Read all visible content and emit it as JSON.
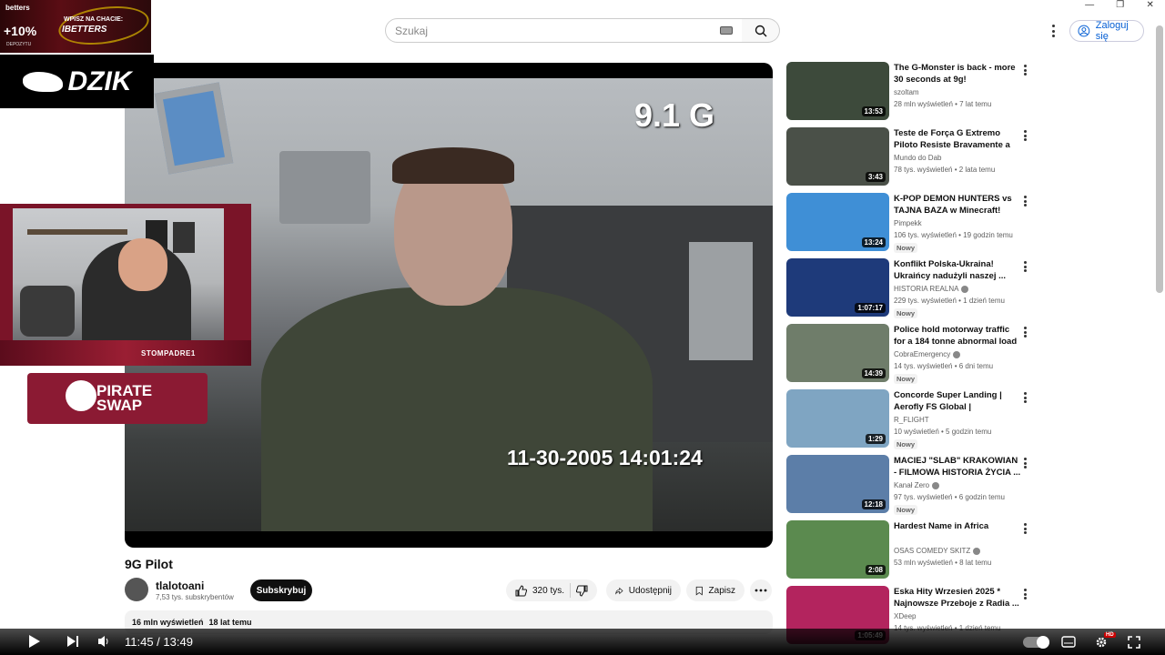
{
  "window": {
    "minimize": "—",
    "restore": "❐",
    "close": "✕"
  },
  "header": {
    "search_placeholder": "Szukaj",
    "signin_label": "Zaloguj się"
  },
  "overlays": {
    "promo": {
      "brand": "betters",
      "bonus": "+10%",
      "bonus_sub": "DEPOZYTU",
      "cta_small": "WPISZ NA CHACIE:",
      "cta_code": "IBETTERS"
    },
    "dzik": "DZIK",
    "cam_handle": "STOMPADRE1",
    "pirate": {
      "line1": "PIRATE",
      "line2": "SWAP"
    }
  },
  "video": {
    "g_readout": "9.1 G",
    "timestamp": "11-30-2005 14:01:24",
    "title": "9G Pilot",
    "channel": "tlalotoani",
    "subscribers": "7,53 tys. subskrybentów",
    "subscribe_label": "Subskrybuj",
    "likes": "320 tys.",
    "share_label": "Udostępnij",
    "save_label": "Zapisz",
    "views": "16 mln wyświetleń",
    "age": "18 lat temu"
  },
  "sidebar": {
    "items": [
      {
        "title": "The G-Monster is back - more 30 seconds at 9g!",
        "channel": "szoltam",
        "verified": false,
        "meta": "28 mln wyświetleń • 7 lat temu",
        "duration": "13:53",
        "badge": "",
        "thumb": "#3d4a3b"
      },
      {
        "title": "Teste de Força G Extremo Piloto Resiste Bravamente a 9G!",
        "channel": "Mundo do Dab",
        "verified": false,
        "meta": "78 tys. wyświetleń • 2 lata temu",
        "duration": "3:43",
        "badge": "",
        "thumb": "#4a5048"
      },
      {
        "title": "K-POP DEMON HUNTERS vs TAJNA BAZA w Minecraft!",
        "channel": "Pimpekk",
        "verified": false,
        "meta": "106 tys. wyświetleń • 19 godzin temu",
        "duration": "13:24",
        "badge": "Nowy",
        "thumb": "#3f8fd6"
      },
      {
        "title": "Konflikt Polska-Ukraina! Ukraińcy nadużyli naszej ...",
        "channel": "HISTORIA REALNA",
        "verified": true,
        "meta": "229 tys. wyświetleń • 1 dzień temu",
        "duration": "1:07:17",
        "badge": "Nowy",
        "thumb": "#1e3a7a"
      },
      {
        "title": "Police hold motorway traffic for a 184 tonne abnormal load ...",
        "channel": "CobraEmergency",
        "verified": true,
        "meta": "14 tys. wyświetleń • 6 dni temu",
        "duration": "14:39",
        "badge": "Nowy",
        "thumb": "#6f7d6a"
      },
      {
        "title": "Concorde Super Landing | Aerofly FS Global | Supersonic...",
        "channel": "R_FLIGHT",
        "verified": false,
        "meta": "10 wyświetleń • 5 godzin temu",
        "duration": "1:29",
        "badge": "Nowy",
        "thumb": "#7fa5c2"
      },
      {
        "title": "MACIEJ \"SLAB\" KRAKOWIAN - FILMOWA HISTORIA ŻYCIA ...",
        "channel": "Kanał Zero",
        "verified": true,
        "meta": "97 tys. wyświetleń • 6 godzin temu",
        "duration": "12:18",
        "badge": "Nowy",
        "thumb": "#5c7ea8"
      },
      {
        "title": "Hardest Name in Africa",
        "channel": "OSAS COMEDY SKITZ",
        "verified": true,
        "meta": "53 mln wyświetleń • 8 lat temu",
        "duration": "2:08",
        "badge": "",
        "thumb": "#5b8a4f"
      },
      {
        "title": "Eska Hity Wrzesień 2025 * Najnowsze Przeboje z Radia ...",
        "channel": "XDeep",
        "verified": false,
        "meta": "14 tys. wyświetleń • 1 dzień temu",
        "duration": "1:05:49",
        "badge": "",
        "thumb": "#b3245e"
      }
    ]
  },
  "player": {
    "time": "11:45 / 13:49",
    "hd": "HD"
  }
}
